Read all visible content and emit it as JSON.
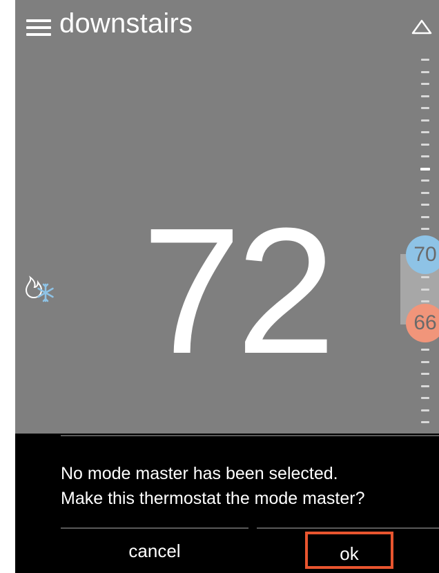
{
  "header": {
    "title": "downstairs",
    "menu_icon": "hamburger-menu-icon",
    "collapse_icon": "triangle-up-icon"
  },
  "thermostat": {
    "current_temperature": "72",
    "mode_icon": "heat-cool-mode-icon",
    "cool_setpoint": "70",
    "heat_setpoint": "66",
    "colors": {
      "background": "#7f7f7f",
      "cool": "#8ec3e6",
      "heat": "#f1957a"
    }
  },
  "dialog": {
    "message": "No mode master has been selected.\nMake this thermostat the mode master?",
    "cancel_label": "cancel",
    "ok_label": "ok",
    "highlight_color": "#e8552f"
  }
}
